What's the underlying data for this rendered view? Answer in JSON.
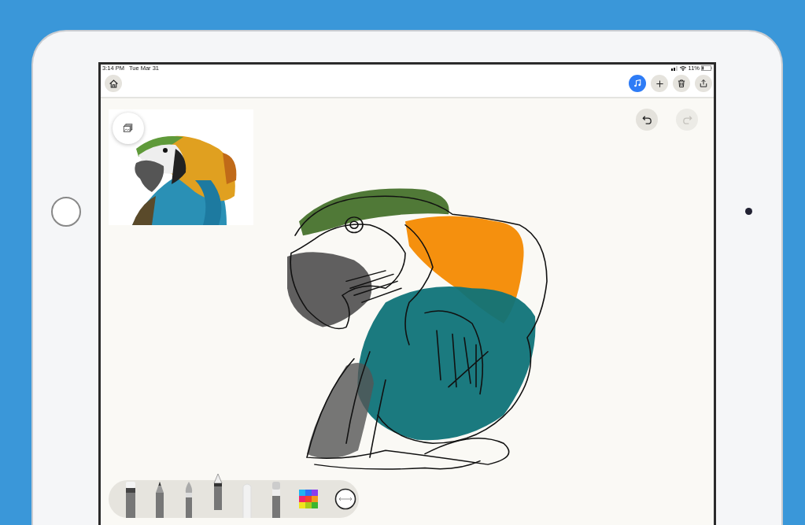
{
  "status_bar": {
    "time": "3:14 PM",
    "date": "Tue Mar 31",
    "battery": "11%"
  },
  "toolbar": [
    {
      "kind": "home",
      "active": false
    },
    {
      "kind": "music",
      "active": true
    },
    {
      "kind": "add",
      "active": false
    },
    {
      "kind": "trash",
      "active": false
    },
    {
      "kind": "share",
      "active": false
    }
  ],
  "history": [
    {
      "kind": "undo",
      "disabled": false
    },
    {
      "kind": "redo",
      "disabled": true
    }
  ],
  "tools": [
    {
      "kind": "marker",
      "selected": false
    },
    {
      "kind": "pencil",
      "selected": false
    },
    {
      "kind": "brush",
      "selected": false
    },
    {
      "kind": "pen",
      "selected": true
    },
    {
      "kind": "eraser",
      "selected": false
    },
    {
      "kind": "watercolor",
      "selected": false
    },
    {
      "kind": "palette",
      "selected": false
    },
    {
      "kind": "size",
      "selected": false
    }
  ]
}
